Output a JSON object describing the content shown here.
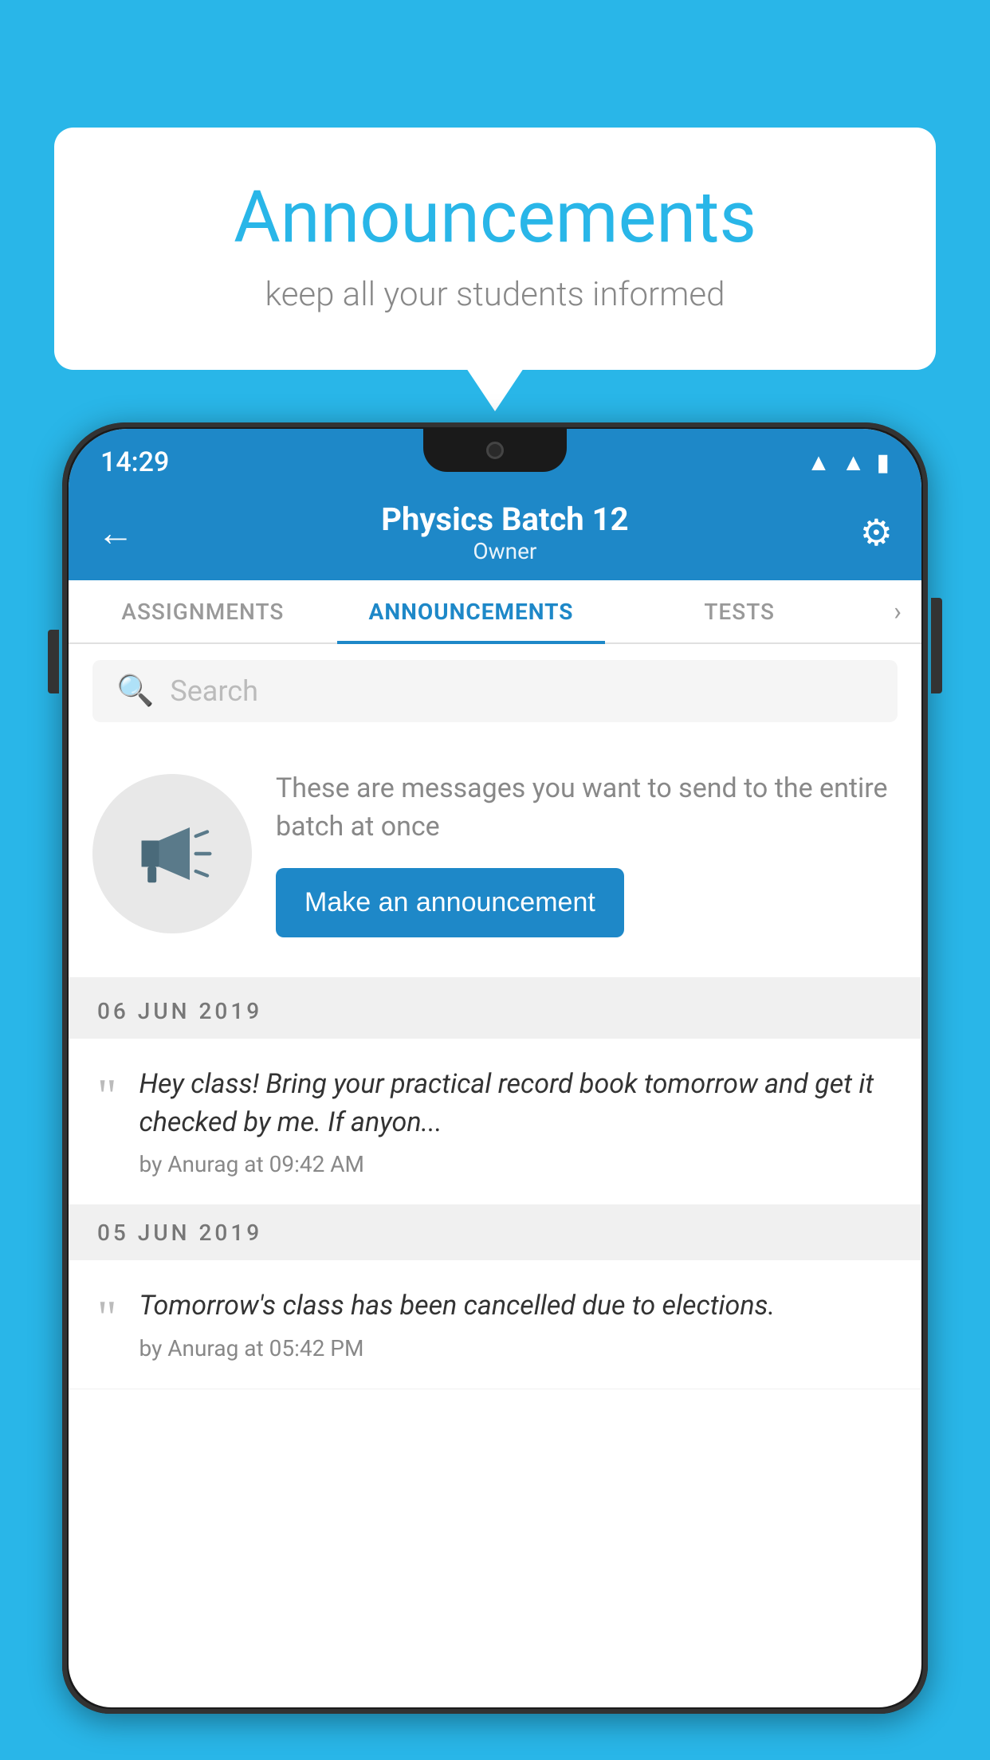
{
  "background_color": "#29B6E8",
  "bubble": {
    "title": "Announcements",
    "subtitle": "keep all your students informed"
  },
  "phone": {
    "status_bar": {
      "time": "14:29"
    },
    "header": {
      "back_label": "←",
      "title": "Physics Batch 12",
      "subtitle": "Owner",
      "gear_symbol": "⚙"
    },
    "tabs": [
      {
        "label": "ASSIGNMENTS",
        "active": false
      },
      {
        "label": "ANNOUNCEMENTS",
        "active": true
      },
      {
        "label": "TESTS",
        "active": false
      }
    ],
    "search": {
      "placeholder": "Search"
    },
    "promo": {
      "description": "These are messages you want to send to the entire batch at once",
      "button_label": "Make an announcement"
    },
    "announcements": [
      {
        "date": "06  JUN  2019",
        "text": "Hey class! Bring your practical record book tomorrow and get it checked by me. If anyon...",
        "meta": "by Anurag at 09:42 AM"
      },
      {
        "date": "05  JUN  2019",
        "text": "Tomorrow's class has been cancelled due to elections.",
        "meta": "by Anurag at 05:42 PM"
      }
    ]
  }
}
